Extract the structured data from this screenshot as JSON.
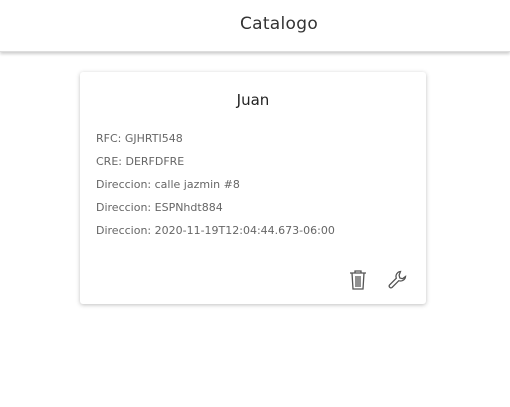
{
  "header": {
    "title": "Catalogo"
  },
  "card": {
    "name": "Juan",
    "fields": [
      "RFC: GJHRTI548",
      "CRE: DERFDFRE",
      "Direccion: calle jazmin #8",
      "Direccion: ESPNhdt884",
      "Direccion: 2020-11-19T12:04:44.673-06:00"
    ]
  }
}
